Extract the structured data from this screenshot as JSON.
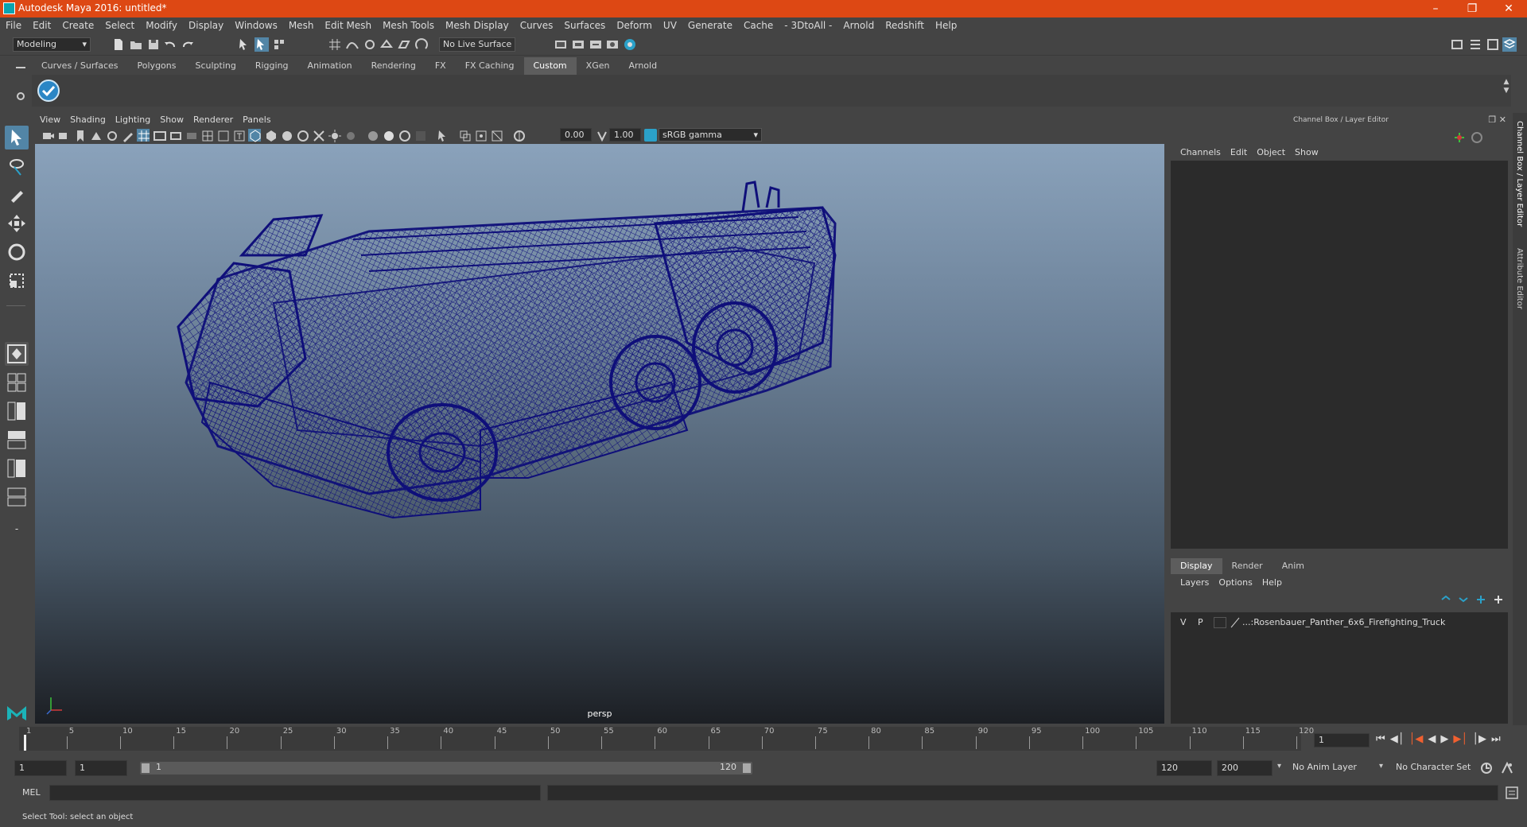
{
  "app": {
    "title": "Autodesk Maya 2016: untitled*"
  },
  "menubar": [
    "File",
    "Edit",
    "Create",
    "Select",
    "Modify",
    "Display",
    "Windows",
    "Mesh",
    "Edit Mesh",
    "Mesh Tools",
    "Mesh Display",
    "Curves",
    "Surfaces",
    "Deform",
    "UV",
    "Generate",
    "Cache",
    "- 3DtoAll -",
    "Arnold",
    "Redshift",
    "Help"
  ],
  "statusline": {
    "mode": "Modeling",
    "live_surface": "No Live Surface"
  },
  "shelf": {
    "tabs": [
      "Curves / Surfaces",
      "Polygons",
      "Sculpting",
      "Rigging",
      "Animation",
      "Rendering",
      "FX",
      "FX Caching",
      "Custom",
      "XGen",
      "Arnold"
    ],
    "active_tab": "Custom"
  },
  "viewport": {
    "menu": [
      "View",
      "Shading",
      "Lighting",
      "Show",
      "Renderer",
      "Panels"
    ],
    "exposure": "0.00",
    "gamma": "1.00",
    "color_space": "sRGB gamma",
    "camera_label": "persp",
    "wire_color": "#0f0f7a"
  },
  "channelbox": {
    "title": "Channel Box / Layer Editor",
    "menu": [
      "Channels",
      "Edit",
      "Object",
      "Show"
    ],
    "layer_tabs": [
      "Display",
      "Render",
      "Anim"
    ],
    "active_layer_tab": "Display",
    "layer_menu": [
      "Layers",
      "Options",
      "Help"
    ],
    "layer": {
      "v": "V",
      "p": "P",
      "name": "...:Rosenbauer_Panther_6x6_Firefighting_Truck"
    }
  },
  "side_tabs": [
    "Channel Box / Layer Editor",
    "Attribute Editor"
  ],
  "timeline": {
    "ticks": [
      "1",
      "5",
      "10",
      "15",
      "20",
      "25",
      "30",
      "35",
      "40",
      "45",
      "50",
      "55",
      "60",
      "65",
      "70",
      "75",
      "80",
      "85",
      "90",
      "95",
      "100",
      "105",
      "110",
      "115",
      "120"
    ],
    "current_frame": "1"
  },
  "range": {
    "start": "1",
    "anim_start": "1",
    "range_start": "1",
    "range_end": "120",
    "anim_end": "120",
    "end": "200",
    "anim_layer": "No Anim Layer",
    "char_set": "No Character Set"
  },
  "cmdline": {
    "label": "MEL"
  },
  "helpline": {
    "text": "Select Tool: select an object"
  }
}
